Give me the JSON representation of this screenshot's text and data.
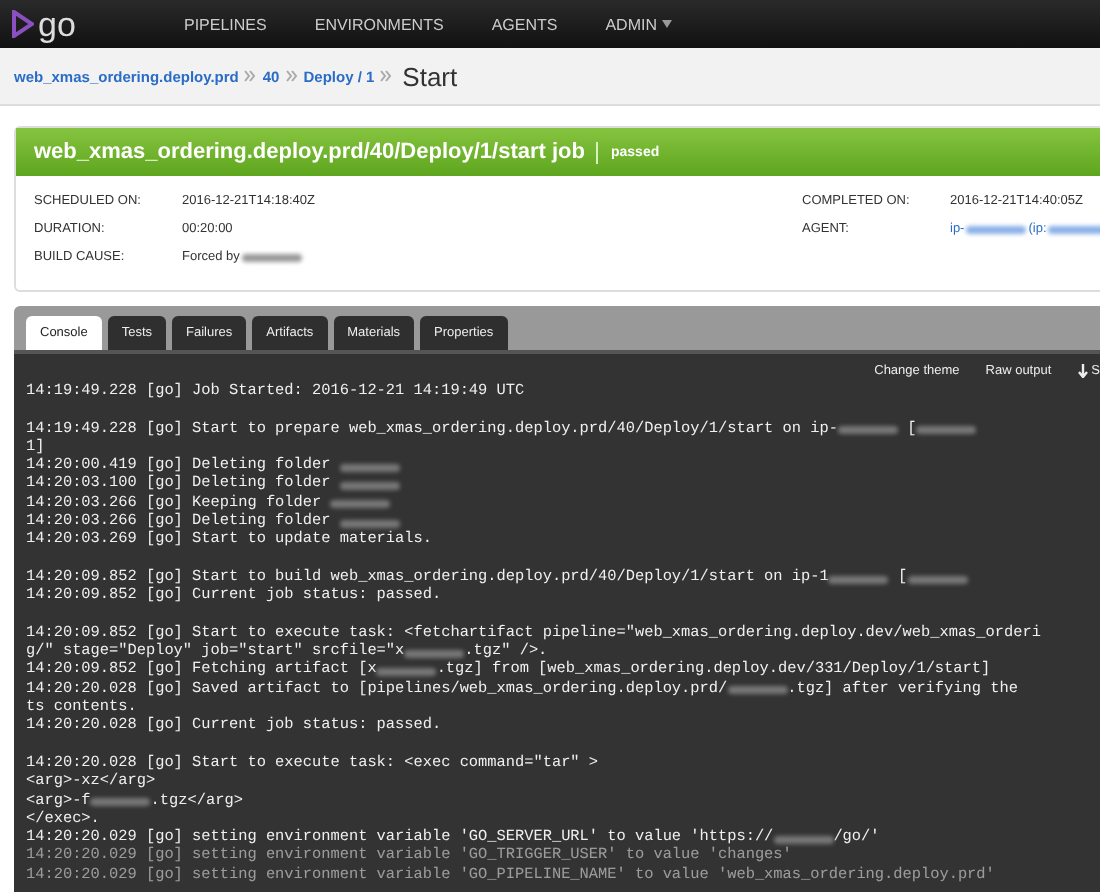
{
  "header": {
    "logo": "go",
    "nav": [
      {
        "label": "PIPELINES",
        "dropdown": false
      },
      {
        "label": "ENVIRONMENTS",
        "dropdown": false
      },
      {
        "label": "AGENTS",
        "dropdown": false
      },
      {
        "label": "ADMIN",
        "dropdown": true
      }
    ]
  },
  "breadcrumb": {
    "links": [
      "web_xmas_ordering.deploy.prd",
      "40",
      "Deploy / 1"
    ],
    "current": "Start"
  },
  "job": {
    "title": "web_xmas_ordering.deploy.prd/40/Deploy/1/start job",
    "status": "passed",
    "left": [
      {
        "label": "SCHEDULED ON:",
        "parts": [
          {
            "kind": "text",
            "text": "2016-12-21T14:18:40Z"
          }
        ]
      },
      {
        "label": "DURATION:",
        "parts": [
          {
            "kind": "text",
            "text": "00:20:00"
          }
        ]
      },
      {
        "label": "BUILD CAUSE:",
        "parts": [
          {
            "kind": "text",
            "text": "Forced by"
          },
          {
            "kind": "redacted"
          }
        ]
      }
    ],
    "right": [
      {
        "label": "COMPLETED ON:",
        "link": false,
        "parts": [
          {
            "kind": "text",
            "text": "2016-12-21T14:40:05Z"
          }
        ]
      },
      {
        "label": "AGENT:",
        "link": true,
        "parts": [
          {
            "kind": "text",
            "text": "ip-"
          },
          {
            "kind": "redacted"
          },
          {
            "kind": "text",
            "text": " (ip:"
          },
          {
            "kind": "redacted"
          }
        ]
      }
    ]
  },
  "tabs": [
    {
      "label": "Console",
      "selected": true
    },
    {
      "label": "Tests",
      "selected": false
    },
    {
      "label": "Failures",
      "selected": false
    },
    {
      "label": "Artifacts",
      "selected": false
    },
    {
      "label": "Materials",
      "selected": false
    },
    {
      "label": "Properties",
      "selected": false
    }
  ],
  "console_actions": [
    {
      "label": "Change theme",
      "icon": false
    },
    {
      "label": "Raw output",
      "icon": false
    },
    {
      "label": "S",
      "icon": true
    }
  ],
  "console_lines": [
    {
      "gap_before": false,
      "faded": false,
      "parts": [
        {
          "kind": "text",
          "text": "14:19:49.228 [go] Job Started: 2016-12-21 14:19:49 UTC"
        }
      ]
    },
    {
      "gap_before": true,
      "faded": false,
      "parts": [
        {
          "kind": "text",
          "text": "14:19:49.228 [go] Start to prepare web_xmas_ordering.deploy.prd/40/Deploy/1/start on ip-"
        },
        {
          "kind": "redacted"
        },
        {
          "kind": "text",
          "text": " ["
        },
        {
          "kind": "redacted"
        }
      ]
    },
    {
      "gap_before": false,
      "faded": false,
      "parts": [
        {
          "kind": "text",
          "text": "1]"
        }
      ]
    },
    {
      "gap_before": false,
      "faded": false,
      "parts": [
        {
          "kind": "text",
          "text": "14:20:00.419 [go] Deleting folder "
        },
        {
          "kind": "redacted"
        }
      ]
    },
    {
      "gap_before": false,
      "faded": false,
      "parts": [
        {
          "kind": "text",
          "text": "14:20:03.100 [go] Deleting folder "
        },
        {
          "kind": "redacted"
        }
      ]
    },
    {
      "gap_before": false,
      "faded": false,
      "parts": [
        {
          "kind": "text",
          "text": "14:20:03.266 [go] Keeping folder "
        },
        {
          "kind": "redacted"
        }
      ]
    },
    {
      "gap_before": false,
      "faded": false,
      "parts": [
        {
          "kind": "text",
          "text": "14:20:03.266 [go] Deleting folder "
        },
        {
          "kind": "redacted"
        }
      ]
    },
    {
      "gap_before": false,
      "faded": false,
      "parts": [
        {
          "kind": "text",
          "text": "14:20:03.269 [go] Start to update materials."
        }
      ]
    },
    {
      "gap_before": true,
      "faded": false,
      "parts": [
        {
          "kind": "text",
          "text": "14:20:09.852 [go] Start to build web_xmas_ordering.deploy.prd/40/Deploy/1/start on ip-1"
        },
        {
          "kind": "redacted"
        },
        {
          "kind": "text",
          "text": " ["
        },
        {
          "kind": "redacted"
        }
      ]
    },
    {
      "gap_before": false,
      "faded": false,
      "parts": [
        {
          "kind": "text",
          "text": "14:20:09.852 [go] Current job status: passed."
        }
      ]
    },
    {
      "gap_before": true,
      "faded": false,
      "parts": [
        {
          "kind": "text",
          "text": "14:20:09.852 [go] Start to execute task: <fetchartifact pipeline=\"web_xmas_ordering.deploy.dev/web_xmas_orderi"
        }
      ]
    },
    {
      "gap_before": false,
      "faded": false,
      "parts": [
        {
          "kind": "text",
          "text": "g/\" stage=\"Deploy\" job=\"start\" srcfile=\"x"
        },
        {
          "kind": "redacted"
        },
        {
          "kind": "text",
          "text": ".tgz\" />."
        }
      ]
    },
    {
      "gap_before": false,
      "faded": false,
      "parts": [
        {
          "kind": "text",
          "text": "14:20:09.852 [go] Fetching artifact [x"
        },
        {
          "kind": "redacted"
        },
        {
          "kind": "text",
          "text": ".tgz] from [web_xmas_ordering.deploy.dev/331/Deploy/1/start]"
        }
      ]
    },
    {
      "gap_before": false,
      "faded": false,
      "parts": [
        {
          "kind": "text",
          "text": "14:20:20.028 [go] Saved artifact to [pipelines/web_xmas_ordering.deploy.prd/"
        },
        {
          "kind": "redacted"
        },
        {
          "kind": "text",
          "text": ".tgz] after verifying the"
        }
      ]
    },
    {
      "gap_before": false,
      "faded": false,
      "parts": [
        {
          "kind": "text",
          "text": "ts contents."
        }
      ]
    },
    {
      "gap_before": false,
      "faded": false,
      "parts": [
        {
          "kind": "text",
          "text": "14:20:20.028 [go] Current job status: passed."
        }
      ]
    },
    {
      "gap_before": true,
      "faded": false,
      "parts": [
        {
          "kind": "text",
          "text": "14:20:20.028 [go] Start to execute task: <exec command=\"tar\" >"
        }
      ]
    },
    {
      "gap_before": false,
      "faded": false,
      "parts": [
        {
          "kind": "text",
          "text": "<arg>-xz</arg>"
        }
      ]
    },
    {
      "gap_before": false,
      "faded": false,
      "parts": [
        {
          "kind": "text",
          "text": "<arg>-f"
        },
        {
          "kind": "redacted"
        },
        {
          "kind": "text",
          "text": ".tgz</arg>"
        }
      ]
    },
    {
      "gap_before": false,
      "faded": false,
      "parts": [
        {
          "kind": "text",
          "text": "</exec>."
        }
      ]
    },
    {
      "gap_before": false,
      "faded": false,
      "parts": [
        {
          "kind": "text",
          "text": "14:20:20.029 [go] setting environment variable 'GO_SERVER_URL' to value 'https://"
        },
        {
          "kind": "redacted"
        },
        {
          "kind": "text",
          "text": "/go/'"
        }
      ]
    },
    {
      "gap_before": false,
      "faded": true,
      "parts": [
        {
          "kind": "text",
          "text": "14:20:20.029 [go] setting environment variable 'GO_TRIGGER_USER' to value 'changes'"
        }
      ]
    },
    {
      "gap_before": false,
      "faded": true,
      "parts": [
        {
          "kind": "text",
          "text": "14:20:20.029 [go] setting environment variable 'GO_PIPELINE_NAME' to value 'web_xmas_ordering.deploy.prd'"
        }
      ]
    }
  ]
}
